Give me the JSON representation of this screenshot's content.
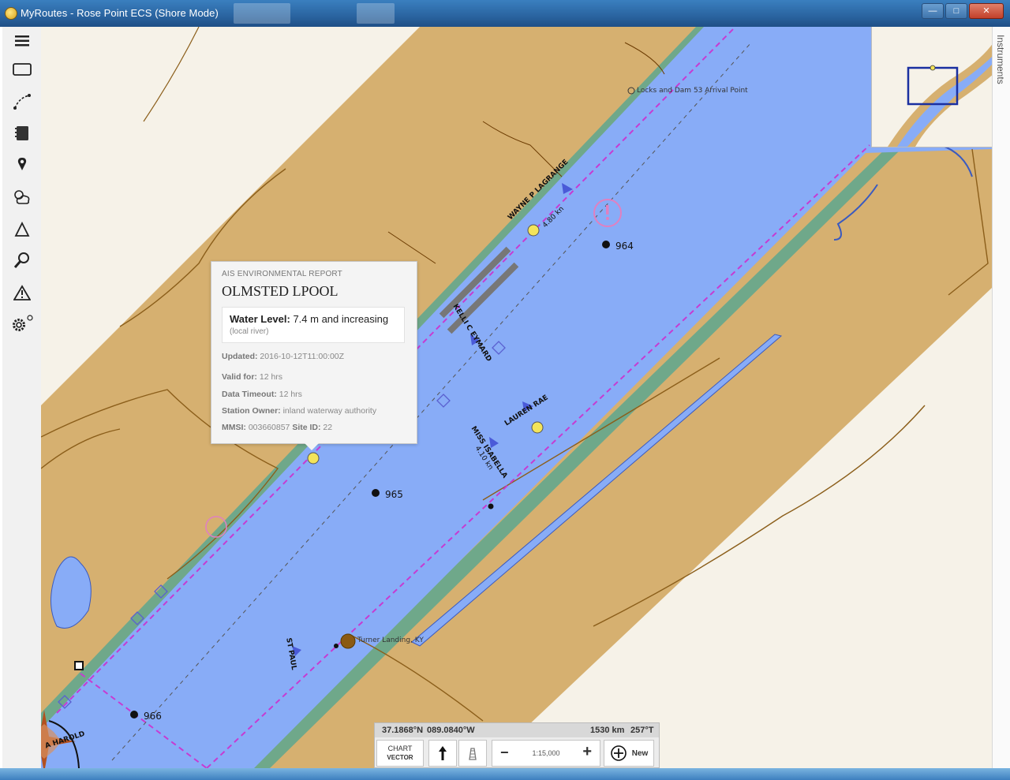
{
  "window": {
    "title": "MyRoutes - Rose Point ECS (Shore Mode)",
    "controls": [
      "minimize-icon",
      "maximize-icon",
      "close-icon"
    ]
  },
  "toolbar": {
    "items": [
      {
        "name": "menu",
        "icon": "hamburger-icon"
      },
      {
        "name": "chart-rectangle",
        "icon": "rectangle-icon"
      },
      {
        "name": "route",
        "icon": "route-icon"
      },
      {
        "name": "logbook",
        "icon": "book-icon"
      },
      {
        "name": "waypoint",
        "icon": "map-pin-icon"
      },
      {
        "name": "weather",
        "icon": "weather-icon"
      },
      {
        "name": "tide-current",
        "icon": "triangle-icon"
      },
      {
        "name": "search",
        "icon": "search-icon"
      },
      {
        "name": "alarms",
        "icon": "warning-icon"
      },
      {
        "name": "settings",
        "icon": "gear-icon"
      }
    ]
  },
  "instruments_label": "Instruments",
  "map": {
    "labels": {
      "locks_and_dam": "Locks and Dam 53 Arrival Point",
      "turner_landing": "Turner Landing, KY",
      "depth_964": "964",
      "depth_965": "965",
      "depth_966": "966"
    },
    "vessels": {
      "wayne_lagrange": "WAYNE P LAGRANGE",
      "wayne_speed": "4.80 kn",
      "kelli_c_eymard": "KELLI C EYMARD",
      "lauren_rae": "LAUREN RAE",
      "miss_isabella": "MISS ISABELLA",
      "miss_isabella_speed": "4.10 kn",
      "st_paul": "ST PAUL",
      "a_harold": "A HAROLD"
    },
    "colors": {
      "water": "#88acf7",
      "land": "#d6b070",
      "shore": "#6fa88a",
      "route": "#c63bd2"
    }
  },
  "popup": {
    "kicker": "AIS ENVIRONMENTAL REPORT",
    "station": "OLMSTED LPOOL",
    "water_level_label": "Water Level:",
    "water_level_value": "7.4 m and increasing",
    "water_level_sub": "(local river)",
    "updated_label": "Updated:",
    "updated_value": "2016-10-12T11:00:00Z",
    "valid_for_label": "Valid for:",
    "valid_for_value": "12 hrs",
    "data_timeout_label": "Data Timeout:",
    "data_timeout_value": "12 hrs",
    "station_owner_label": "Station Owner:",
    "station_owner_value": "inland waterway authority",
    "mmsi_label": "MMSI:",
    "mmsi_value": "003660857",
    "site_id_label": "Site ID:",
    "site_id_value": "22"
  },
  "statusbar": {
    "lat": "37.1868°N",
    "lon": "089.0840°W",
    "range": "1530 km",
    "bearing": "257°T",
    "chart_label": "CHART",
    "chart_mode": "VECTOR",
    "scale": "1:15,000",
    "zoom_out": "−",
    "zoom_in": "+",
    "new_label": "New"
  }
}
